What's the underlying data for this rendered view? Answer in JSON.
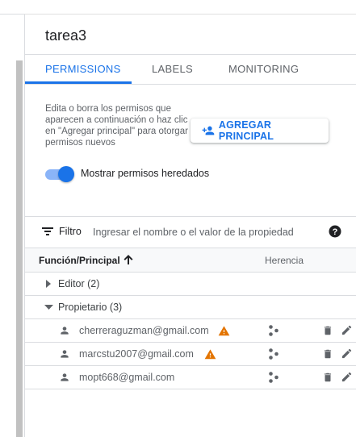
{
  "resource": {
    "title": "tarea3"
  },
  "tabs": [
    {
      "label": "PERMISSIONS",
      "active": true
    },
    {
      "label": "LABELS",
      "active": false
    },
    {
      "label": "MONITORING",
      "active": false
    }
  ],
  "permissions": {
    "description": "Edita o borra los permisos que aparecen a continuación o haz clic en \"Agregar principal\" para otorgar permisos nuevos",
    "add_button_label": "AGREGAR PRINCIPAL",
    "show_inherited_label": "Mostrar permisos heredados",
    "show_inherited_on": true
  },
  "filter": {
    "label": "Filtro",
    "placeholder": "Ingresar el nombre o el valor de la propiedad"
  },
  "table": {
    "col_principal": "Función/Principal",
    "col_inheritance": "Herencia",
    "groups": [
      {
        "label": "Editor (2)",
        "expanded": false,
        "members": []
      },
      {
        "label": "Propietario (3)",
        "expanded": true,
        "members": [
          {
            "email": "cherreraguzman@gmail.com",
            "warning": true
          },
          {
            "email": "marcstu2007@gmail.com",
            "warning": true
          },
          {
            "email": "mopt668@gmail.com",
            "warning": false
          }
        ]
      }
    ]
  },
  "colors": {
    "accent": "#1a73e8",
    "warning": "#e37400"
  }
}
